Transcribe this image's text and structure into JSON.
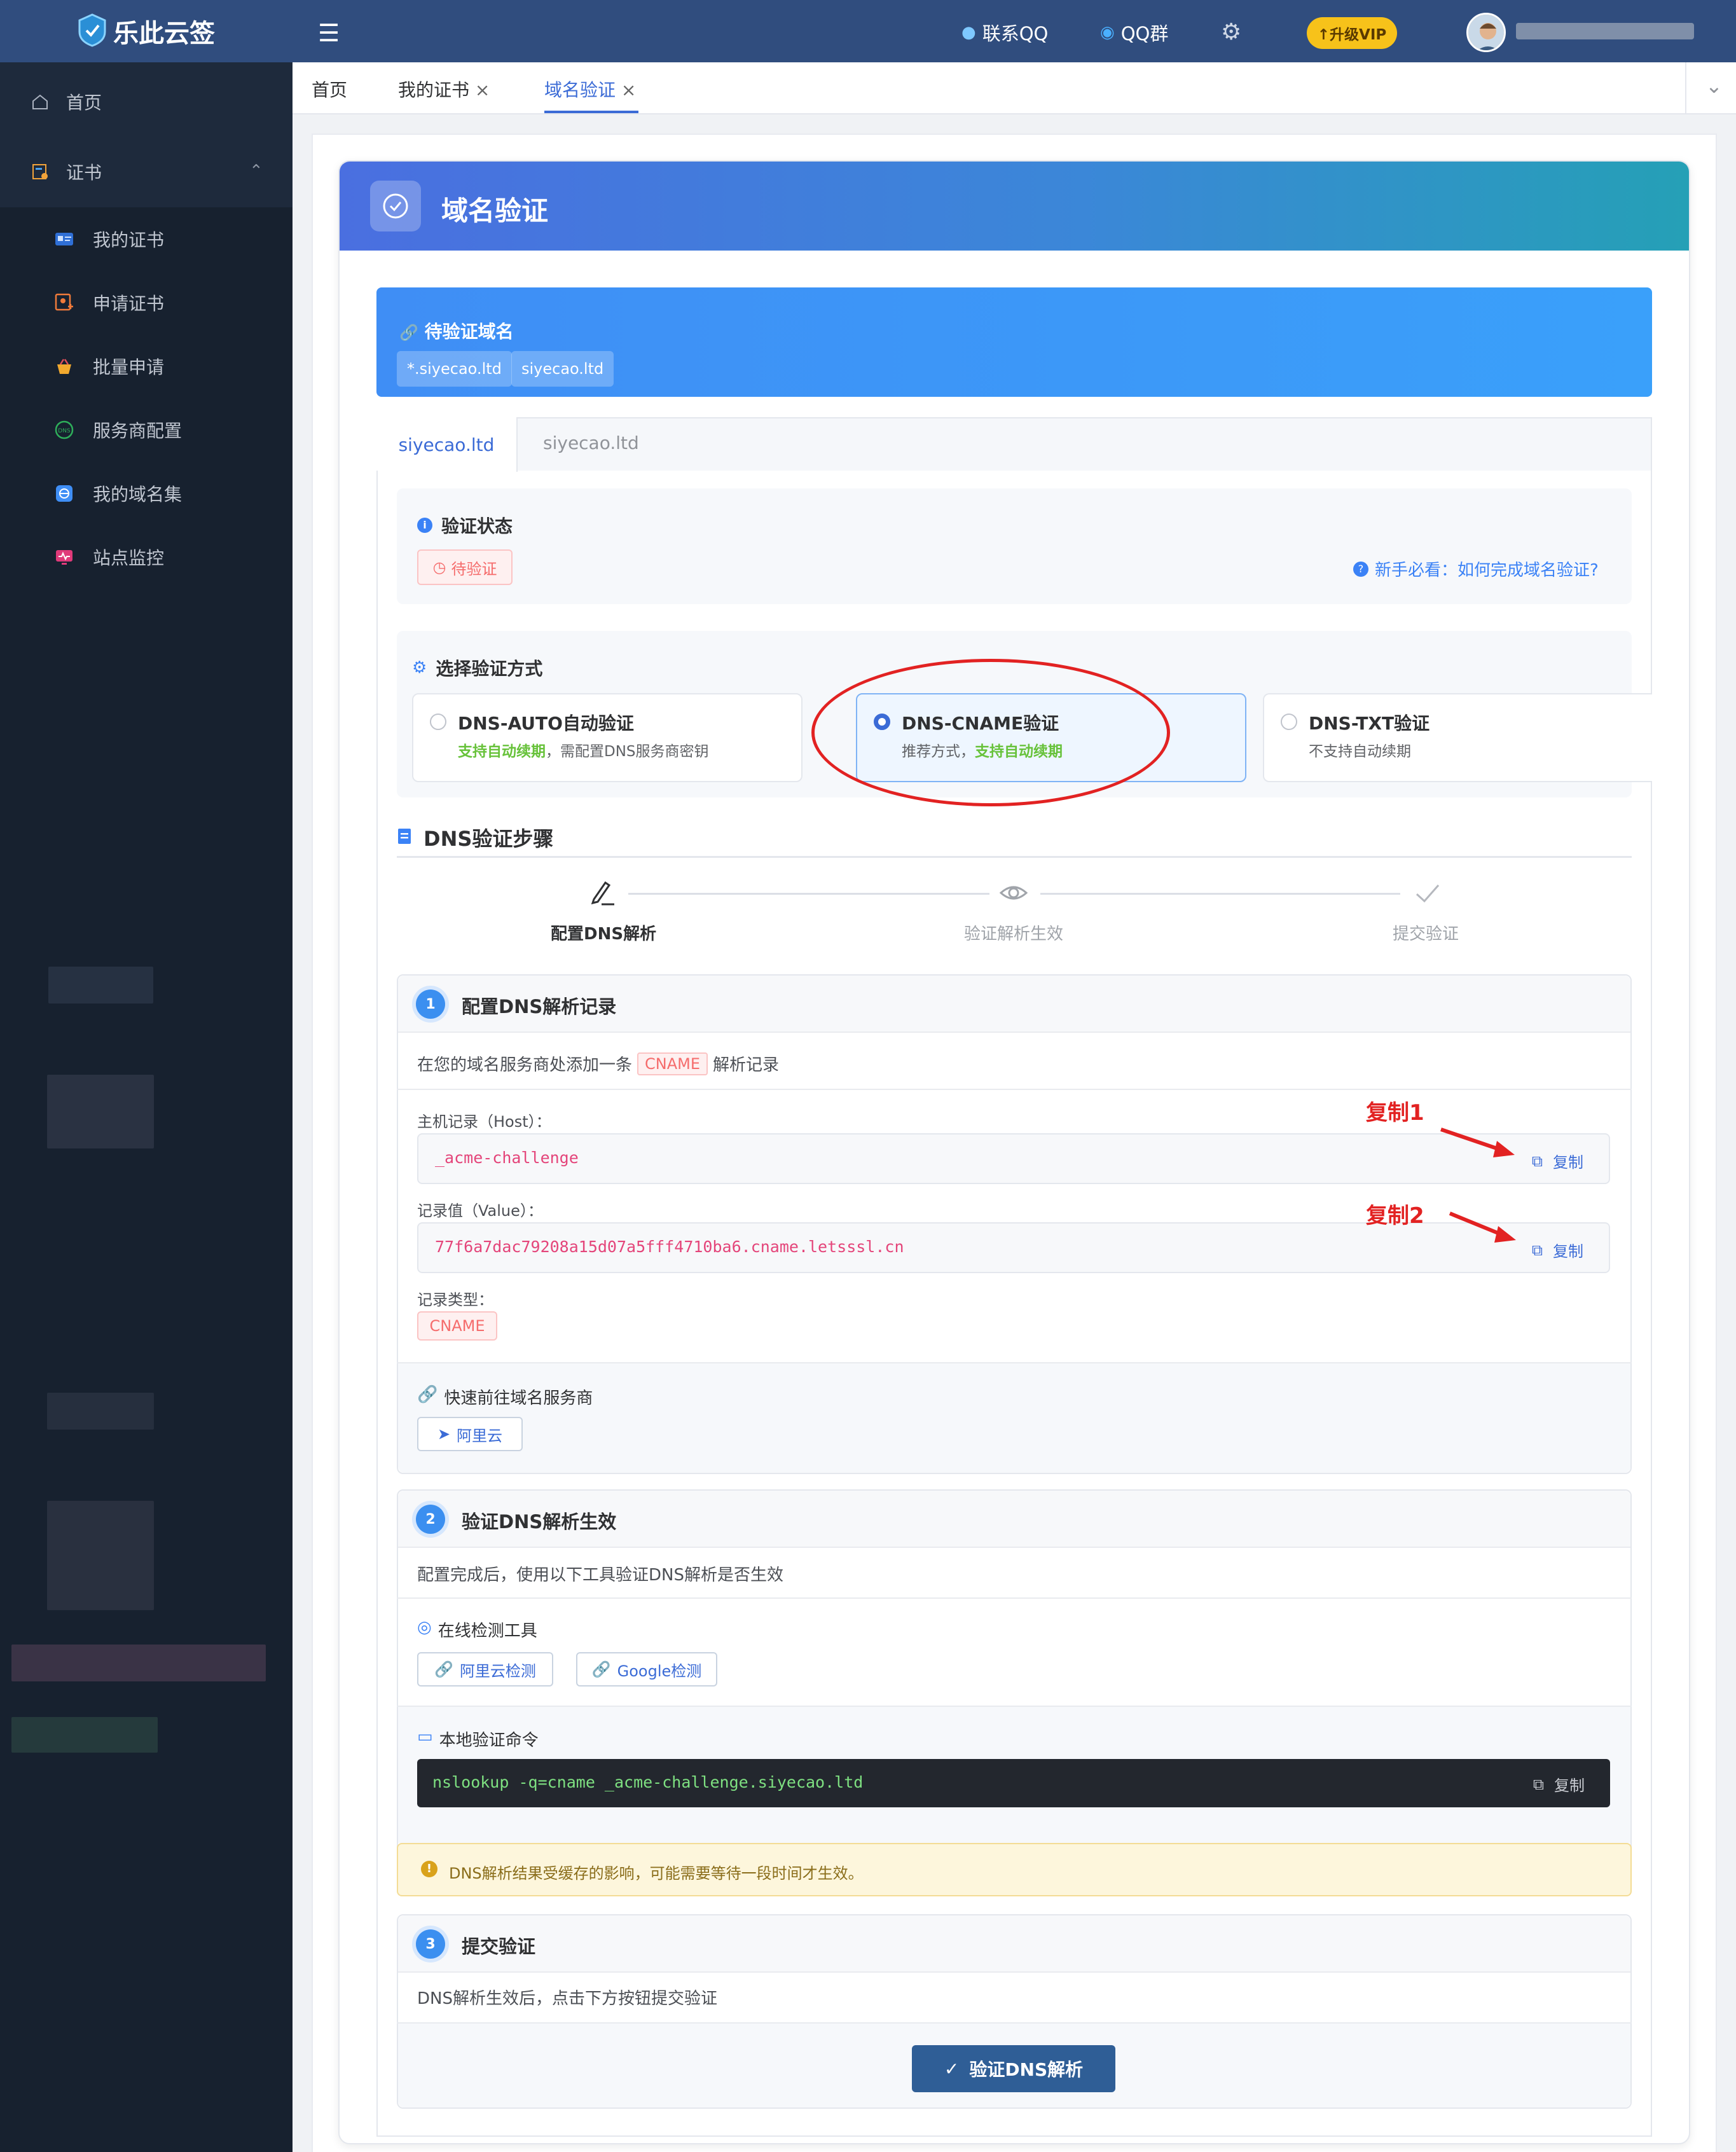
{
  "app": {
    "name": "乐此云签"
  },
  "header": {
    "contact_qq": "联系QQ",
    "qq_group": "QQ群",
    "vip_label": "↑升级VIP"
  },
  "sidebar": {
    "items": [
      {
        "label": "首页",
        "icon": "home-icon"
      },
      {
        "label": "证书",
        "icon": "certificate-icon"
      },
      {
        "label": "我的证书",
        "icon": "id-card-icon"
      },
      {
        "label": "申请证书",
        "icon": "apply-icon"
      },
      {
        "label": "批量申请",
        "icon": "basket-icon"
      },
      {
        "label": "服务商配置",
        "icon": "dns-icon"
      },
      {
        "label": "我的域名集",
        "icon": "domain-set-icon"
      },
      {
        "label": "站点监控",
        "icon": "monitor-icon"
      }
    ]
  },
  "tabs": [
    {
      "label": "首页"
    },
    {
      "label": "我的证书",
      "close": "×"
    },
    {
      "label": "域名验证",
      "close": "×"
    }
  ],
  "page": {
    "title": "域名验证",
    "pending_domains_label": "待验证域名",
    "pending_domains": [
      "*.siyecao.ltd",
      "siyecao.ltd"
    ],
    "domain_tabs": [
      "siyecao.ltd",
      "siyecao.ltd"
    ],
    "status_label": "验证状态",
    "status_value": "待验证",
    "help_link": "新手必看：如何完成域名验证?",
    "method_label": "选择验证方式",
    "methods": [
      {
        "title": "DNS-AUTO自动验证",
        "desc_green": "支持自动续期",
        "desc": "，需配置DNS服务商密钥",
        "selected": false
      },
      {
        "title": "DNS-CNAME验证",
        "desc_prefix": "推荐方式，",
        "desc_green": "支持自动续期",
        "selected": true
      },
      {
        "title": "DNS-TXT验证",
        "desc": "不支持自动续期",
        "selected": false
      }
    ],
    "steps_title": "DNS验证步骤",
    "steps": [
      "配置DNS解析",
      "验证解析生效",
      "提交验证"
    ],
    "step1": {
      "num": "1",
      "title": "配置DNS解析记录",
      "intro_before": "在您的域名服务商处添加一条",
      "intro_tag": "CNAME",
      "intro_after": "解析记录",
      "host_label": "主机记录（Host）：",
      "host_value": "_acme-challenge",
      "value_label": "记录值（Value）：",
      "value_value": "77f6a7dac79208a15d07a5fff4710ba6.cname.letsssl.cn",
      "type_label": "记录类型：",
      "type_value": "CNAME",
      "copy_label": "复制",
      "quick_label": "快速前往域名服务商",
      "provider_button": "阿里云"
    },
    "annotations": {
      "copy1": "复制1",
      "copy2": "复制2"
    },
    "step2": {
      "num": "2",
      "title": "验证DNS解析生效",
      "intro": "配置完成后，使用以下工具验证DNS解析是否生效",
      "tools_label": "在线检测工具",
      "tool_buttons": [
        "阿里云检测",
        "Google检测"
      ],
      "local_label": "本地验证命令",
      "command": "nslookup -q=cname _acme-challenge.siyecao.ltd",
      "copy_label": "复制",
      "warning": "DNS解析结果受缓存的影响，可能需要等待一段时间才生效。"
    },
    "step3": {
      "num": "3",
      "title": "提交验证",
      "intro": "DNS解析生效后，点击下方按钮提交验证",
      "submit_button": "验证DNS解析"
    }
  }
}
